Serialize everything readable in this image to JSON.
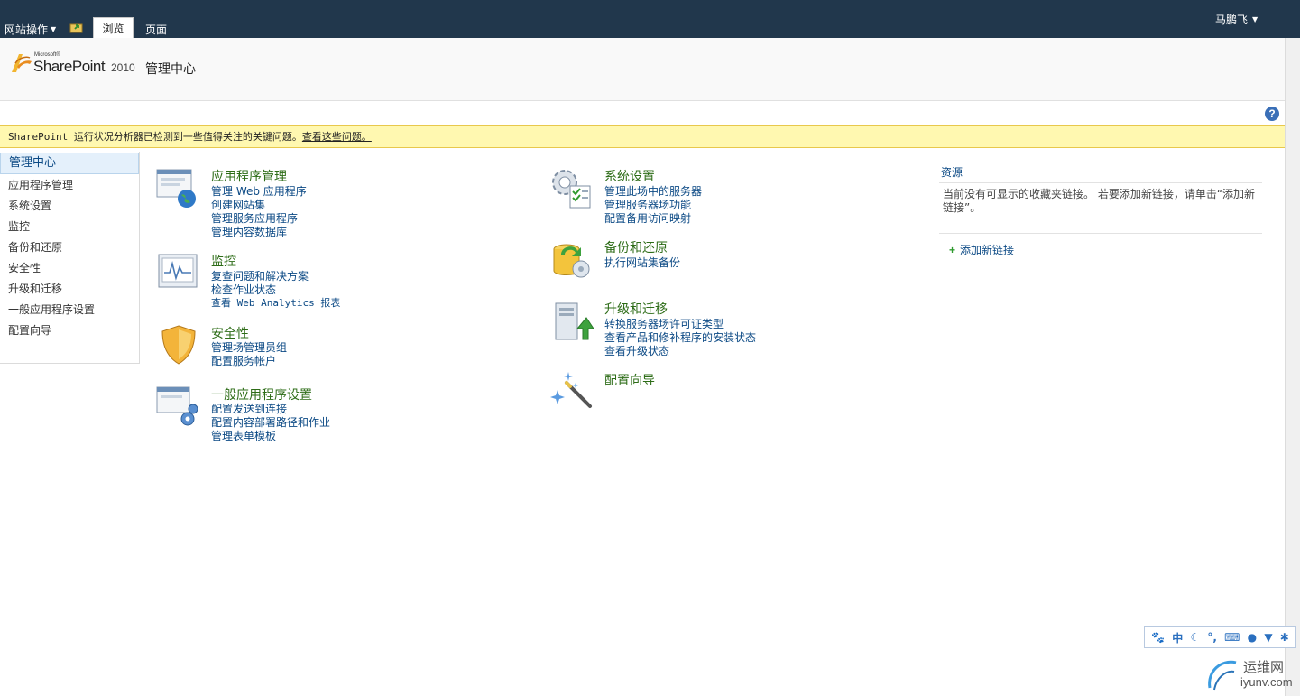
{
  "ribbon": {
    "site_actions": "网站操作",
    "tab_browse": "浏览",
    "tab_page": "页面",
    "user": "马鹏飞"
  },
  "brand": {
    "microsoft": "Microsoft®",
    "sharepoint": "SharePoint",
    "year": "2010",
    "page_title": "管理中心"
  },
  "status": {
    "message": "SharePoint 运行状况分析器已检测到一些值得关注的关键问题。",
    "link": "查看这些问题。"
  },
  "leftnav": {
    "header": "管理中心",
    "items": [
      "应用程序管理",
      "系统设置",
      "监控",
      "备份和还原",
      "安全性",
      "升级和迁移",
      "一般应用程序设置",
      "配置向导"
    ]
  },
  "sections": {
    "app_mgmt": {
      "title": "应用程序管理",
      "links": [
        "管理 Web 应用程序",
        "创建网站集",
        "管理服务应用程序",
        "管理内容数据库"
      ]
    },
    "monitoring": {
      "title": "监控",
      "links": [
        "复查问题和解决方案",
        "检查作业状态",
        "查看 Web Analytics 报表"
      ]
    },
    "security": {
      "title": "安全性",
      "links": [
        "管理场管理员组",
        "配置服务帐户"
      ]
    },
    "general": {
      "title": "一般应用程序设置",
      "links": [
        "配置发送到连接",
        "配置内容部署路径和作业",
        "管理表单模板"
      ]
    },
    "system": {
      "title": "系统设置",
      "links": [
        "管理此场中的服务器",
        "管理服务器场功能",
        "配置备用访问映射"
      ]
    },
    "backup": {
      "title": "备份和还原",
      "links": [
        "执行网站集备份"
      ]
    },
    "upgrade": {
      "title": "升级和迁移",
      "links": [
        "转换服务器场许可证类型",
        "查看产品和修补程序的安装状态",
        "查看升级状态"
      ]
    },
    "wizards": {
      "title": "配置向导"
    }
  },
  "resources": {
    "title": "资源",
    "empty_text": "当前没有可显示的收藏夹链接。 若要添加新链接，请单击“添加新链接”。",
    "add_link": "添加新链接"
  },
  "ime": {
    "lang": "中"
  },
  "watermark": {
    "cn": "运维网",
    "domain": "iyunv.com"
  },
  "colors": {
    "ribbon_bg": "#21374c",
    "section_title": "#2d6c17",
    "link": "#0c4a85",
    "status_bg": "#fff8b0"
  }
}
